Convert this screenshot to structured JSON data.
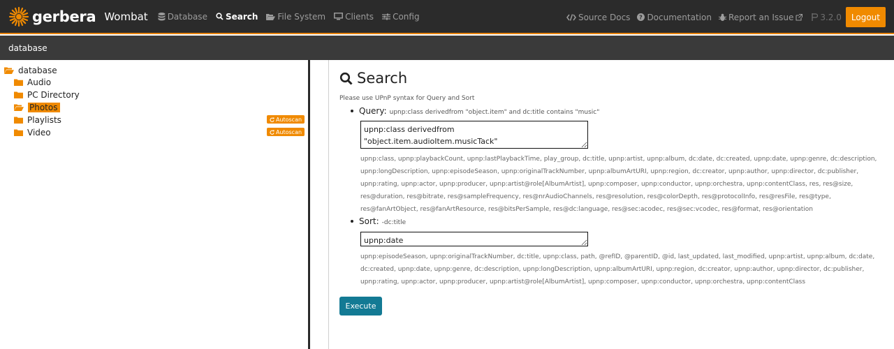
{
  "brand": {
    "name": "gerbera",
    "release": "Wombat"
  },
  "nav": {
    "left": [
      {
        "label": "Database",
        "icon": "database-icon"
      },
      {
        "label": "Search",
        "icon": "search-icon",
        "active": true
      },
      {
        "label": "File System",
        "icon": "folder-open-icon"
      },
      {
        "label": "Clients",
        "icon": "monitor-icon"
      },
      {
        "label": "Config",
        "icon": "sliders-icon"
      }
    ],
    "right": {
      "source_docs": "Source Docs",
      "documentation": "Documentation",
      "report_issue": "Report an Issue",
      "version": "3.2.0",
      "logout": "Logout"
    }
  },
  "breadcrumb": "database",
  "tree": {
    "root": "database",
    "items": [
      {
        "label": "Audio"
      },
      {
        "label": "PC Directory"
      },
      {
        "label": "Photos",
        "selected": true
      },
      {
        "label": "Playlists",
        "badge": "Autoscan"
      },
      {
        "label": "Video",
        "badge": "Autoscan"
      }
    ]
  },
  "main": {
    "title": "Search",
    "hint": "Please use UPnP syntax for Query and Sort",
    "query": {
      "label": "Query:",
      "example": "upnp:class derivedfrom \"object.item\" and dc:title contains \"music\"",
      "value": "upnp:class derivedfrom \"object.item.audioItem.musicTack\"\nand dc:title contains \"wallaby\"",
      "properties": [
        "upnp:class, upnp:playbackCount, upnp:lastPlaybackTime, play_group, dc:title, upnp:artist, upnp:album, dc:date, dc:created, upnp:date, upnp:genre, dc:description,",
        "upnp:longDescription, upnp:episodeSeason, upnp:originalTrackNumber, upnp:albumArtURI, upnp:region, dc:creator, upnp:author, upnp:director, dc:publisher,",
        "upnp:rating, upnp:actor, upnp:producer, upnp:artist@role[AlbumArtist], upnp:composer, upnp:conductor, upnp:orchestra, upnp:contentClass, res, res@size,",
        "res@duration, res@bitrate, res@sampleFrequency, res@nrAudioChannels, res@resolution, res@colorDepth, res@protocolInfo, res@resFile, res@type,",
        "res@fanArtObject, res@fanArtResource, res@bitsPerSample, res@dc:language, res@sec:acodec, res@sec:vcodec, res@format, res@orientation"
      ]
    },
    "sort": {
      "label": "Sort:",
      "example": "-dc:title",
      "value": "upnp:date",
      "properties": [
        "upnp:episodeSeason, upnp:originalTrackNumber, dc:title, upnp:class, path, @refID, @parentID, @id, last_updated, last_modified, upnp:artist, upnp:album, dc:date,",
        "dc:created, upnp:date, upnp:genre, dc:description, upnp:longDescription, upnp:albumArtURI, upnp:region, dc:creator, upnp:author, upnp:director, dc:publisher,",
        "upnp:rating, upnp:actor, upnp:producer, upnp:artist@role[AlbumArtist], upnp:composer, upnp:conductor, upnp:orchestra, upnp:contentClass"
      ]
    },
    "execute": "Execute"
  },
  "colors": {
    "accent": "#f08a00",
    "navbar": "#2b2b2b",
    "button": "#137a94"
  }
}
